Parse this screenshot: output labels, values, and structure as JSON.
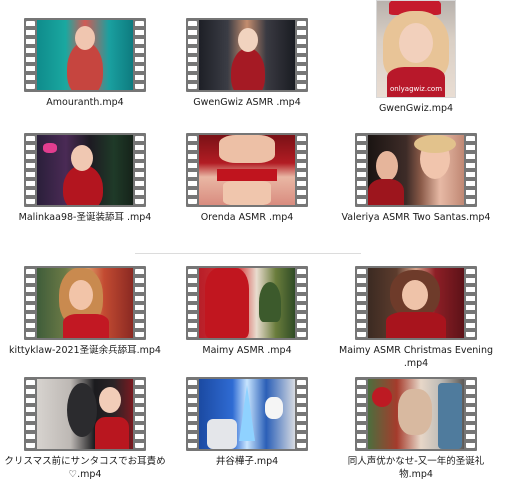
{
  "files": [
    {
      "name": "Amouranth.mp4",
      "type": "video",
      "thumb": {
        "bg": "linear-gradient(90deg,#0f8c8c 0%,#1aa8a0 30%,#d25a54 50%,#1aa0a0 75%,#0e7b7f 100%)",
        "accent": "#c6453f",
        "skin": "#f0c0a8"
      }
    },
    {
      "name": "GwenGwiz ASMR .mp4",
      "type": "video",
      "thumb": {
        "bg": "linear-gradient(90deg,#1d1f26 0%,#3b3d45 30%,#c48d6e 50%,#3a3a42 70%,#1a1c22 100%)",
        "accent": "#a51a24",
        "skin": "#f1d3bf"
      }
    },
    {
      "name": "GwenGwiz.mp4",
      "type": "image",
      "watermark": "onlyagwiz.com",
      "thumb": {
        "bg": "linear-gradient(180deg,#b8b2ad 0%,#d9cfc5 40%,#e9ddd3 100%)",
        "accent": "#b8182a",
        "skin": "#f2d0bc"
      }
    },
    {
      "name": "Malinkaa98-圣诞装舔耳 .mp4",
      "type": "video",
      "thumb": {
        "bg": "linear-gradient(90deg,#2a1f3a 0%,#4a2a55 30%,#1d1a22 55%,#1f3a28 80%,#16231a 100%)",
        "accent": "#b3151f",
        "skin": "#f0c8b2"
      }
    },
    {
      "name": "Orenda ASMR .mp4",
      "type": "video",
      "thumb": {
        "bg": "linear-gradient(180deg,#7a1116 0%,#b21c23 40%,#e9b7a4 60%,#d98c7f 100%)",
        "accent": "#c0141e",
        "skin": "#edc0a6"
      }
    },
    {
      "name": "Valeriya ASMR Two Santas.mp4",
      "type": "video",
      "thumb": {
        "bg": "linear-gradient(90deg,#1a1412 0%,#3e2c28 40%,#8a5a48 55%,#e7b9a5 75%,#c08874 100%)",
        "accent": "#9d151d",
        "skin": "#f1c5ad"
      }
    },
    {
      "name": "kittyklaw-2021圣诞余兵舔耳.mp4",
      "type": "video",
      "thumb": {
        "bg": "linear-gradient(90deg,#3f5d3a 0%,#6c7a46 30%,#e0a56e 50%,#c34b32 70%,#8a2922 100%)",
        "accent": "#c21823",
        "skin": "#f2c4a8"
      }
    },
    {
      "name": "Maimy ASMR .mp4",
      "type": "video",
      "thumb": {
        "bg": "linear-gradient(90deg,#b81e28 0%,#d43a3a 40%,#e9dccf 60%,#6a7d3c 80%,#2f4b25 100%)",
        "accent": "#c1161f",
        "skin": "#f0cbb5"
      }
    },
    {
      "name": "Maimy ASMR Christmas Evening .mp4",
      "type": "video",
      "thumb": {
        "bg": "linear-gradient(90deg,#3b2a22 0%,#5d3c2d 30%,#d8a58d 50%,#8e1f26 70%,#5c1218 100%)",
        "accent": "#a8141d",
        "skin": "#efc3a9"
      }
    },
    {
      "name": "クリスマス前にサンタコスでお耳責め♡.mp4",
      "type": "video",
      "thumb": {
        "bg": "linear-gradient(90deg,#d7d3cf 0%,#bdb8b4 35%,#1b1b1e 60%,#2a2426 80%,#7a1920 100%)",
        "accent": "#b9161f",
        "skin": "#f1cdb8"
      }
    },
    {
      "name": "井谷樺子.mp4",
      "type": "video",
      "thumb": {
        "bg": "linear-gradient(90deg,#1b4aa2 0%,#2f6bd3 35%,#c8e5ff 50%,#2b5fb7 70%,#d7dbe2 100%)",
        "accent": "#c0161f",
        "skin": "#eec8b2"
      }
    },
    {
      "name": "同人声优かなせ-又一年的圣诞礼物.mp4",
      "type": "video",
      "thumb": {
        "bg": "linear-gradient(90deg,#4c6e3e 0%,#a53b2c 30%,#e7d7c8 55%,#c0bdb8 75%,#5d5a57 100%)",
        "accent": "#bd1a23",
        "skin": "#eec9b4"
      }
    }
  ]
}
